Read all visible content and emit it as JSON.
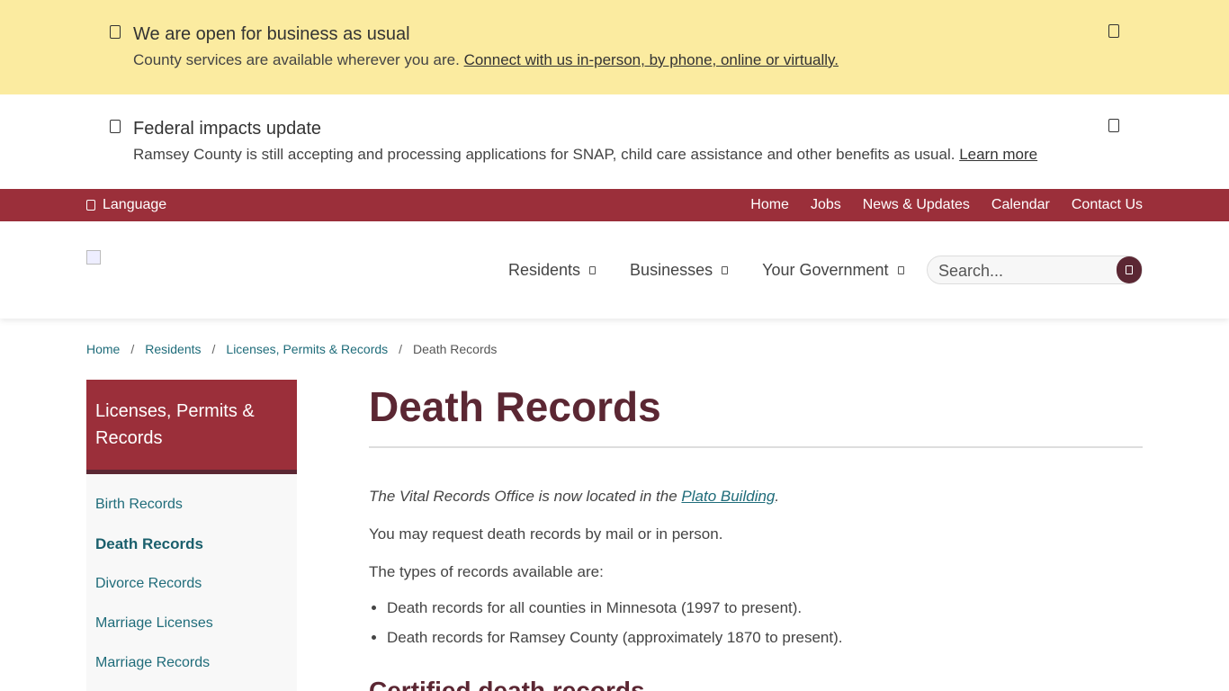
{
  "alerts": [
    {
      "title": "We are open for business as usual",
      "body_prefix": "County services are available wherever you are. ",
      "link": "Connect with us in-person, by phone, online or virtually."
    },
    {
      "title": "Federal impacts update",
      "body_prefix": "Ramsey County is still accepting and processing applications for SNAP, child care assistance and other benefits as usual. ",
      "link": "Learn more"
    }
  ],
  "utility": {
    "language_label": "Language",
    "links": [
      "Home",
      "Jobs",
      "News & Updates",
      "Calendar",
      "Contact Us"
    ]
  },
  "nav": {
    "items": [
      "Residents",
      "Businesses",
      "Your Government"
    ],
    "search_placeholder": "Search..."
  },
  "breadcrumb": {
    "items": [
      "Home",
      "Residents",
      "Licenses, Permits & Records"
    ],
    "current": "Death Records",
    "separator": "/"
  },
  "sidebar": {
    "heading": "Licenses, Permits & Records",
    "items": [
      "Birth Records",
      "Death Records",
      "Divorce Records",
      "Marriage Licenses",
      "Marriage Records"
    ],
    "active": "Death Records"
  },
  "main": {
    "title": "Death Records",
    "intro_prefix": "The Vital Records Office is now located in the ",
    "intro_link": "Plato Building",
    "intro_suffix": ".",
    "para1": "You may request death records by mail or in person.",
    "para2": "The types of records available are:",
    "bullets": [
      "Death records for all counties in Minnesota (1997 to present).",
      "Death records for Ramsey County (approximately 1870 to present)."
    ],
    "subheading": "Certified death records"
  },
  "colors": {
    "alert_yellow": "#fbeba0",
    "brand_red": "#9b2f3a",
    "brand_dark": "#5b2733",
    "link_teal": "#1f6c7a"
  }
}
